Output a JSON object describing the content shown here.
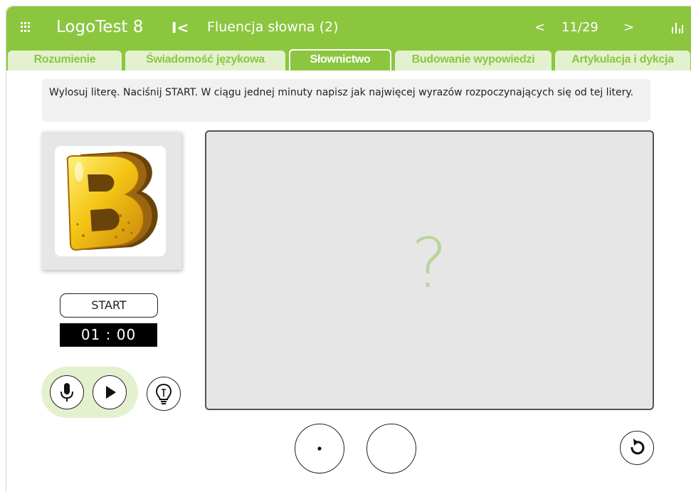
{
  "header": {
    "app_title": "LogoTest 8",
    "first_glyph": "I<",
    "section_title": "Fluencja słowna (2)",
    "prev_glyph": "<",
    "page_counter": "11/29",
    "next_glyph": ">",
    "accent_color": "#8cc63f"
  },
  "tabs": [
    {
      "label": "Rozumienie",
      "active": false
    },
    {
      "label": "Świadomość językowa",
      "active": false
    },
    {
      "label": "Słownictwo",
      "active": true
    },
    {
      "label": "Budowanie wypowiedzi",
      "active": false
    },
    {
      "label": "Artykulacja i dykcja",
      "active": false
    }
  ],
  "instruction": "Wylosuj literę. Naciśnij START. W ciągu jednej minuty napisz jak najwięcej wyrazów rozpoczynających się od tej litery.",
  "letter_card": {
    "icon": "letter-b-image"
  },
  "start_button": "START",
  "timer": "01 : 00",
  "answer_panel": {
    "placeholder_glyph": "?"
  },
  "icons": {
    "grid": "grid-menu-icon",
    "stats": "bar-chart-icon",
    "mic": "microphone-icon",
    "play": "play-icon",
    "hint": "lightbulb-icon",
    "reset": "refresh-icon"
  }
}
